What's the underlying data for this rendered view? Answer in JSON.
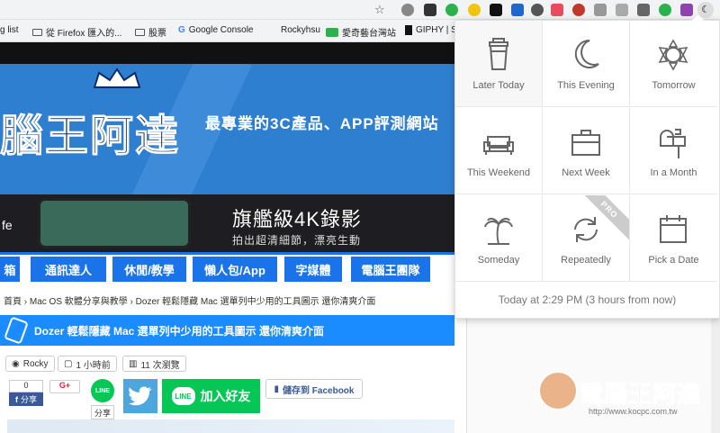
{
  "bookmarks": [
    {
      "label": "g list",
      "type": "text"
    },
    {
      "label": "從 Firefox 匯入的...",
      "type": "folder"
    },
    {
      "label": "股票",
      "type": "folder"
    },
    {
      "label": "Google Console",
      "type": "google"
    },
    {
      "label": "Rockyhsu",
      "type": "text"
    },
    {
      "label": "愛奇藝台灣站",
      "type": "iqiyi"
    },
    {
      "label": "GIPHY | S",
      "type": "giphy"
    }
  ],
  "site": {
    "banner_title": "腦王阿達",
    "banner_slogan": "最專業的3C產品、APP評測網站",
    "ad_title": "旗艦級4K錄影",
    "ad_subtitle": "拍出超清細節，漂亮生動",
    "ad_left_text": "fe",
    "nav": [
      "箱",
      "通訊達人",
      "休閒/教學",
      "懶人包/App",
      "字媒體",
      "電腦王團隊"
    ],
    "breadcrumb": "首頁 › Mac OS 軟體分享與教學 › Dozer 輕鬆隱藏 Mac 選單列中少用的工具圖示 還你清爽介面",
    "article_title": "Dozer 輕鬆隱藏 Mac 選單列中少用的工具圖示 還你清爽介面",
    "author": "Rocky",
    "time_ago": "1 小時前",
    "views": "11 次瀏覽",
    "fb_count": "0",
    "fb_share": "分享",
    "gplus": "G+",
    "line_icon_text": "LINE",
    "line_share": "分享",
    "line_add": "加入好友",
    "fb_save": "儲存到 Facebook"
  },
  "snooze": {
    "options": [
      {
        "label": "Later Today",
        "icon": "coffee-cup-icon"
      },
      {
        "label": "This Evening",
        "icon": "moon-icon"
      },
      {
        "label": "Tomorrow",
        "icon": "sun-icon"
      },
      {
        "label": "This Weekend",
        "icon": "sofa-icon"
      },
      {
        "label": "Next Week",
        "icon": "briefcase-icon"
      },
      {
        "label": "In a Month",
        "icon": "mailbox-icon"
      },
      {
        "label": "Someday",
        "icon": "palm-tree-icon"
      },
      {
        "label": "Repeatedly",
        "icon": "repeat-icon"
      },
      {
        "label": "Pick a Date",
        "icon": "calendar-icon"
      }
    ],
    "pro_badge": "PRO",
    "footer": "Today at 2:29 PM (3 hours from now)"
  },
  "watermark": {
    "title": "電腦王阿達",
    "url": "http://www.kocpc.com.tw"
  },
  "colors": {
    "accent": "#1a73e8",
    "line_green": "#06c755",
    "facebook": "#3b5998",
    "twitter": "#4da7de"
  }
}
